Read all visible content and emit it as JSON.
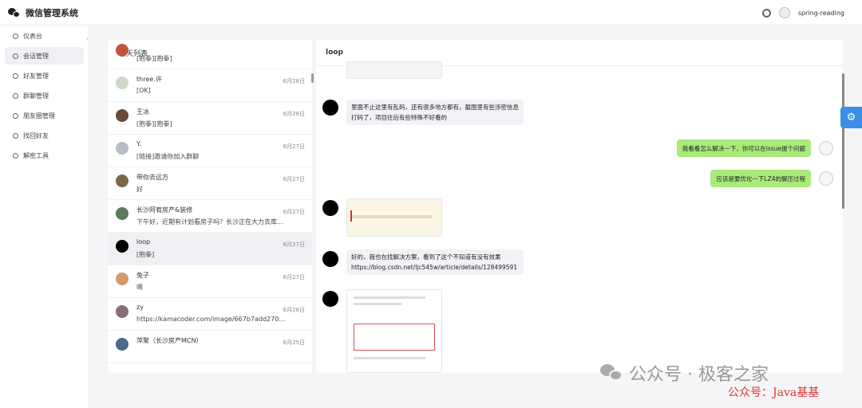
{
  "app": {
    "title": "微信管理系统",
    "user_name": "spring-reading"
  },
  "sidebar": {
    "items": [
      {
        "label": "仪表台",
        "icon": "dashboard-icon"
      },
      {
        "label": "会话管理",
        "icon": "chat-icon",
        "active": true
      },
      {
        "label": "好友管理",
        "icon": "friends-icon"
      },
      {
        "label": "群聊管理",
        "icon": "group-icon"
      },
      {
        "label": "朋友圈管理",
        "icon": "moments-icon"
      },
      {
        "label": "找回好友",
        "icon": "recover-icon"
      },
      {
        "label": "解密工具",
        "icon": "key-icon"
      }
    ]
  },
  "chatlist": {
    "title": "聊天列表",
    "items": [
      {
        "name": "",
        "msg": "[抱拳][抱拳]",
        "time": "",
        "color": "#c2553a"
      },
      {
        "name": "three.许",
        "msg": "[OK]",
        "time": "6月28日",
        "color": "#cfd8c4"
      },
      {
        "name": "王冰",
        "msg": "[抱拳][抱拳]",
        "time": "6月28日",
        "color": "#6b4a35"
      },
      {
        "name": "Y.",
        "msg": "[链接]邀请你加入群聊",
        "time": "6月27日",
        "color": "#b8bcc6"
      },
      {
        "name": "带你去远方",
        "msg": "好",
        "time": "6月27日",
        "color": "#7a6a4a"
      },
      {
        "name": "长沙阿宥房产&装修",
        "msg": "下午好，近期有计划看房子吗？长沙正在大力去库...",
        "time": "6月27日",
        "color": "#5d7a5a"
      },
      {
        "name": "loop",
        "msg": "[抱拳]",
        "time": "6月27日",
        "color": "#000000",
        "active": true
      },
      {
        "name": "兔子",
        "msg": "嗯",
        "time": "6月27日",
        "color": "#d49a6a"
      },
      {
        "name": "zy",
        "msg": "https://kamacoder.com/image/667b7add270b0vq...",
        "time": "6月26日",
        "color": "#8a6e7a"
      },
      {
        "name": "萍聚（长沙房产MCN）",
        "msg": "",
        "time": "6月25日",
        "color": "#4a6a8a"
      }
    ]
  },
  "chat": {
    "title": "loop",
    "messages": [
      {
        "side": "left",
        "text": "里面不止这里有乱码，还有很多地方都有，截图里有些涉密信息打码了，项目往后有些特殊不好看的"
      },
      {
        "side": "right",
        "text": "我看看怎么解决一下，你可以在issue提个问题"
      },
      {
        "side": "right",
        "text": "应该是要优化一下LZ4的解压过程"
      },
      {
        "side": "left",
        "text": "好的，我也在找解决方案，看到了这个不知道有没有效果"
      },
      {
        "side": "left",
        "text": "https://blog.csdn.net/ljc545w/article/details/128499591"
      }
    ]
  },
  "watermark": {
    "text": "公众号 · 极客之家",
    "text2": "公众号：Java基基"
  }
}
